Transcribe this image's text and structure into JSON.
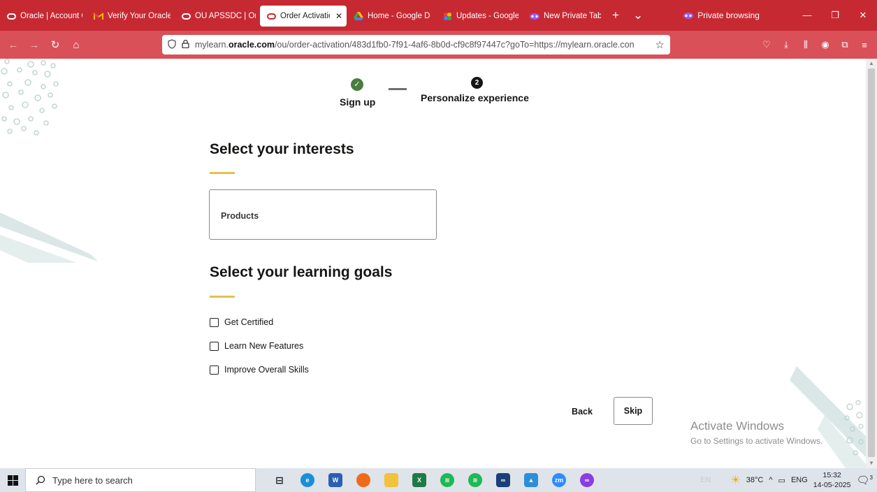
{
  "browser": {
    "tabs": [
      {
        "title": "Oracle | Account C",
        "icon": "oracle-icon"
      },
      {
        "title": "Verify Your Oracle",
        "icon": "gmail-icon"
      },
      {
        "title": "OU APSSDC | Orac",
        "icon": "oracle-icon"
      },
      {
        "title": "Order Activatio",
        "icon": "oracle-icon",
        "active": true
      },
      {
        "title": "Home - Google D",
        "icon": "google-drive-icon"
      },
      {
        "title": "Updates - Google",
        "icon": "google-photos-icon"
      },
      {
        "title": "New Private Tab",
        "icon": "private-mask-icon"
      }
    ],
    "new_tab_symbol": "+",
    "tab_list_symbol": "⌄",
    "private_label": "Private browsing",
    "url": {
      "prefix": "mylearn.",
      "host": "oracle.com",
      "path": "/ou/order-activation/483d1fb0-7f91-4af6-8b0d-cf9c8f97447c?goTo=https://mylearn.oracle.con"
    },
    "accent_color": "#c72933"
  },
  "stepper": {
    "step1": {
      "label": "Sign up",
      "status": "complete",
      "icon": "check-icon"
    },
    "step2": {
      "label": "Personalize experience",
      "number": "2",
      "status": "current"
    }
  },
  "interests": {
    "heading": "Select your interests",
    "products_label": "Products"
  },
  "goals": {
    "heading": "Select your learning goals",
    "options": [
      {
        "label": "Get Certified",
        "checked": false
      },
      {
        "label": "Learn New Features",
        "checked": false
      },
      {
        "label": "Improve Overall Skills",
        "checked": false
      }
    ]
  },
  "actions": {
    "back_label": "Back",
    "skip_label": "Skip"
  },
  "watermark": {
    "line1": "Activate Windows",
    "line2": "Go to Settings to activate Windows."
  },
  "taskbar": {
    "search_placeholder": "Type here to search",
    "apps": [
      "task-view-icon",
      "edge-icon",
      "word-icon",
      "firefox-icon",
      "file-explorer-icon",
      "excel-icon",
      "spotify-icon",
      "spotify-icon",
      "webex-icon",
      "photos-icon",
      "zoom-icon",
      "firefox-private-icon"
    ],
    "temperature": "38°C",
    "language": "ENG",
    "time": "15:32",
    "date": "14-05-2025",
    "notifications": "3",
    "ime_hint": "EN"
  },
  "colors": {
    "accent_yellow": "#e2c14f",
    "step_done": "#4a7d3b",
    "text": "#161513"
  }
}
